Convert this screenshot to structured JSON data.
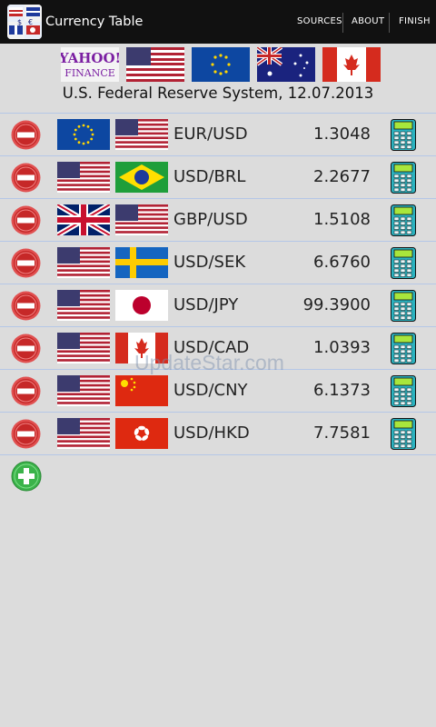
{
  "app": {
    "title": "Currency Table",
    "actions": [
      "SOURCES",
      "ABOUT",
      "FINISH"
    ]
  },
  "sources": {
    "yahoo_logo_text": [
      "YAHOO!",
      "FINANCE"
    ],
    "flags": [
      "us-flag",
      "eu-flag",
      "au-flag",
      "ca-flag"
    ],
    "label": "U.S. Federal Reserve System, 12.07.2013"
  },
  "rows": [
    {
      "pair": "EUR/USD",
      "rate": "1.3048",
      "from_flag": "eu-flag",
      "to_flag": "us-flag"
    },
    {
      "pair": "USD/BRL",
      "rate": "2.2677",
      "from_flag": "us-flag",
      "to_flag": "br-flag"
    },
    {
      "pair": "GBP/USD",
      "rate": "1.5108",
      "from_flag": "gb-flag",
      "to_flag": "us-flag"
    },
    {
      "pair": "USD/SEK",
      "rate": "6.6760",
      "from_flag": "us-flag",
      "to_flag": "se-flag"
    },
    {
      "pair": "USD/JPY",
      "rate": "99.3900",
      "from_flag": "us-flag",
      "to_flag": "jp-flag"
    },
    {
      "pair": "USD/CAD",
      "rate": "1.0393",
      "from_flag": "us-flag",
      "to_flag": "ca-flag"
    },
    {
      "pair": "USD/CNY",
      "rate": "6.1373",
      "from_flag": "us-flag",
      "to_flag": "cn-flag"
    },
    {
      "pair": "USD/HKD",
      "rate": "7.7581",
      "from_flag": "us-flag",
      "to_flag": "hk-flag"
    }
  ],
  "icons": {
    "remove": "minus-circle-icon",
    "calculator": "calculator-icon",
    "add": "plus-circle-icon"
  },
  "colors": {
    "background": "#dcdcdc",
    "actionbar": "#111111",
    "divider": "#b5c7e7",
    "remove_red": "#d32f2f",
    "add_green": "#3bb34a",
    "calculator_teal": "#2bb3c0"
  },
  "watermark": "UpdateStar.com"
}
